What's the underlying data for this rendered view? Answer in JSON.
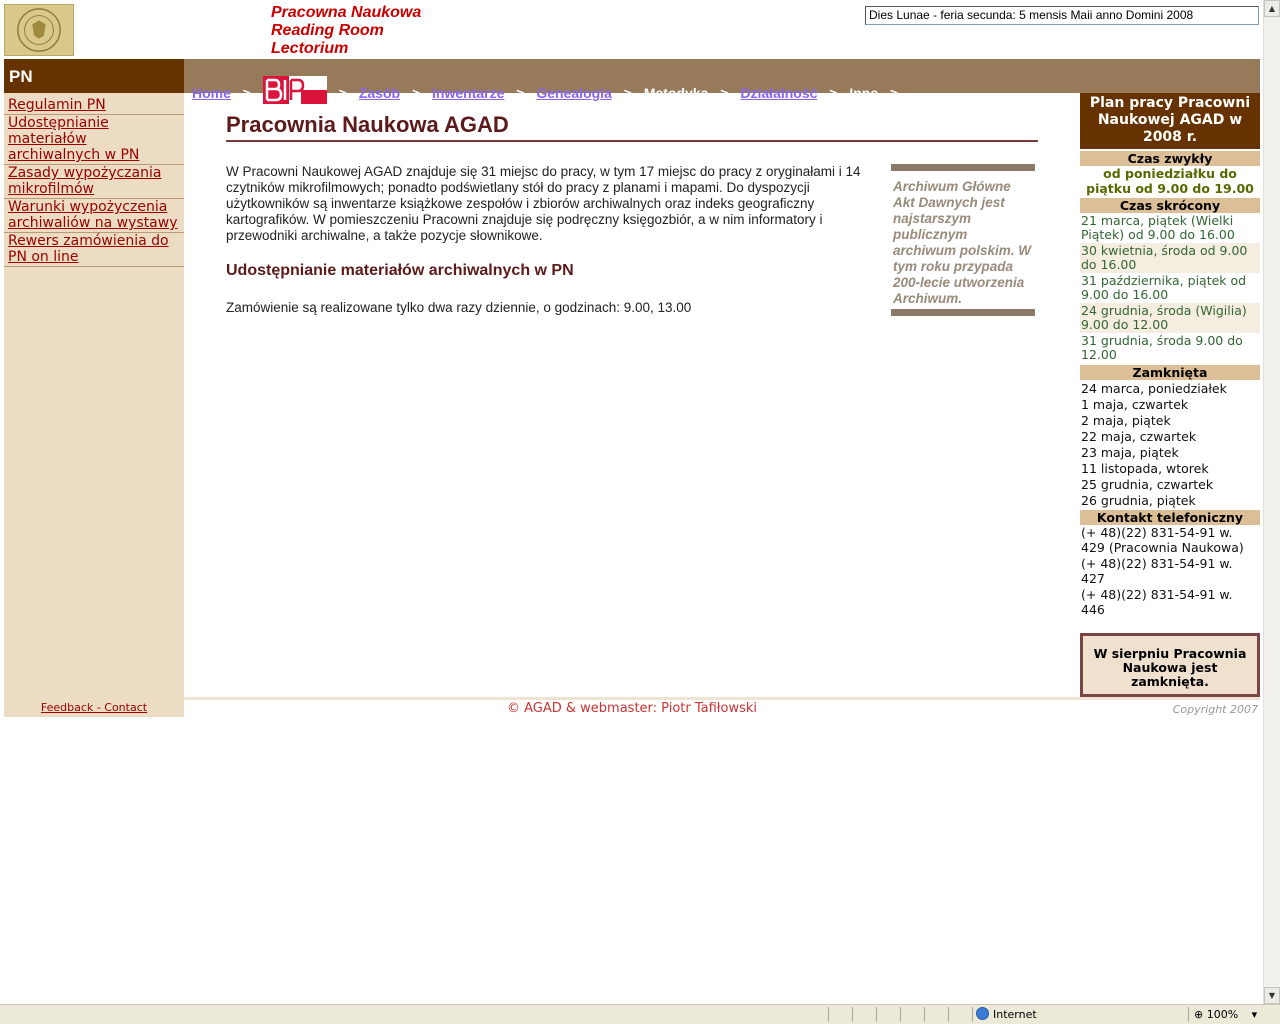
{
  "header": {
    "logo_icon": "archive-seal-icon",
    "title_lines": [
      "Pracowna Naukowa",
      "Reading Room",
      "Lectorium"
    ],
    "date_text": "Dies Lunae - feria secunda: 5 mensis Maii anno Domini 2008"
  },
  "sidebar": {
    "heading": "PN",
    "items": [
      {
        "label": "Regulamin PN"
      },
      {
        "label": "Udostępnianie materiałów archiwalnych w PN"
      },
      {
        "label": "Zasady wypożyczania mikrofilmów"
      },
      {
        "label": "Warunki wypożyczenia archiwaliów na wystawy"
      },
      {
        "label": "Rewers zamówienia do PN on line"
      }
    ],
    "feedback": "Feedback - Contact"
  },
  "nav": {
    "separator": ">",
    "items": [
      {
        "label": "Home"
      },
      {
        "label": "BIP",
        "icon": "bip-logo-icon"
      },
      {
        "label": "Zasób"
      },
      {
        "label": "Inwentarze"
      },
      {
        "label": "Genealogia"
      },
      {
        "label": "Metodyka"
      },
      {
        "label": "Działalność"
      },
      {
        "label": "Inne"
      }
    ]
  },
  "main": {
    "title": "Pracownia Naukowa AGAD",
    "intro": "W Pracowni Naukowej AGAD znajduje się 31 miejsc do pracy, w tym 17 miejsc do pracy z oryginałami i 14 czytników mikrofilmowych; ponadto podświetlany stół do pracy z planami i mapami. Do dyspozycji użytkowników są inwentarze książkowe zespołów i zbiorów archiwalnych oraz indeks geograficzny kartografików. W pomieszczeniu Pracowni znajduje się podręczny księgozbiór, a w nim informatory i przewodniki archiwalne, a także pozycje słownikowe.",
    "subheading": "Udostępnianie materiałów archiwalnych w PN",
    "order_info": "Zamówienie są realizowane tylko dwa razy dziennie, o godzinach: 9.00, 13.00",
    "quote": "Archiwum Główne Akt Dawnych jest najstarszym publicznym archiwum polskim. W tym roku przypada 200-lecie utworzenia Archiwum."
  },
  "schedule": {
    "title": "Plan pracy Pracowni Naukowej AGAD w 2008 r.",
    "regular_head": "Czas zwykły",
    "regular_hours": "od poniedziałku do piątku od 9.00 do 19.00",
    "short_head": "Czas skrócony",
    "short_days": [
      "21 marca, piątek (Wielki Piątek) od 9.00 do 16.00",
      "30 kwietnia, środa od 9.00 do 16.00",
      "31 października, piątek od 9.00 do 16.00",
      "24 grudnia, środa (Wigilia) 9.00 do 12.00",
      "31 grudnia, środa 9.00 do 12.00"
    ],
    "closed_head": "Zamknięta",
    "closed_days": [
      "24 marca, poniedziałek",
      "1 maja, czwartek",
      "2 maja, piątek",
      "22 maja, czwartek",
      "23 maja, piątek",
      "11 listopada, wtorek",
      "25 grudnia, czwartek",
      "26 grudnia, piątek"
    ],
    "phone_head": "Kontakt telefoniczny",
    "phones": [
      "(+ 48)(22) 831-54-91 w. 429 (Pracownia Naukowa)",
      "(+ 48)(22) 831-54-91 w. 427",
      "(+ 48)(22) 831-54-91 w. 446"
    ],
    "notice": "W sierpniu Pracownia Naukowa jest zamknięta."
  },
  "footer": {
    "credit": "© AGAD & webmaster: Piotr Tafiłowski",
    "copyright": "Copyright 2007"
  },
  "statusbar": {
    "zone": "Internet",
    "zoom": "100%"
  }
}
